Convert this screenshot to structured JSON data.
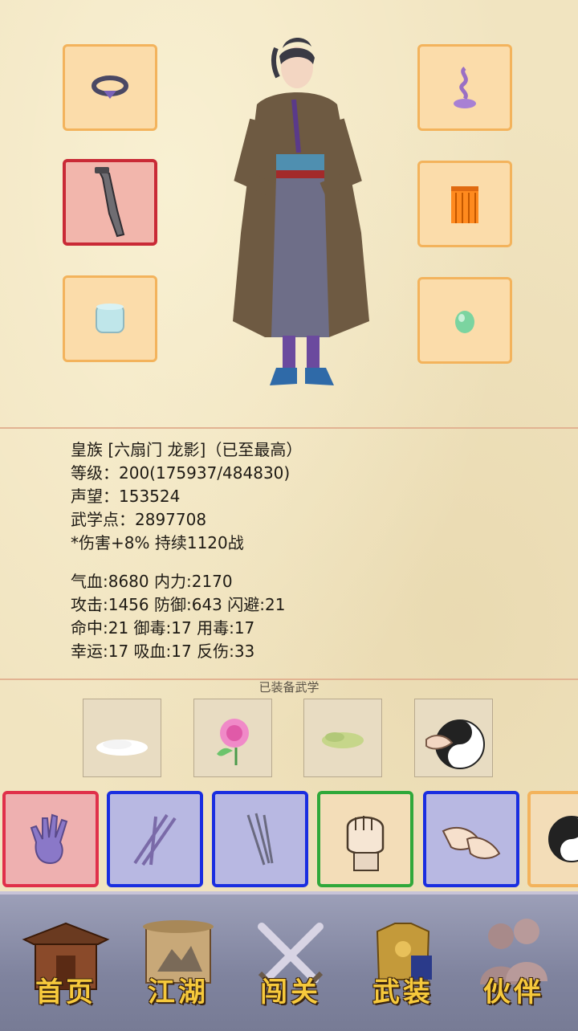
{
  "character": {
    "title_line": "皇族 [六扇门 龙影]（已至最高）",
    "level_line": "等级：200(175937/484830)",
    "reputation_line": "声望：153524",
    "martial_points_line": "武学点：2897708",
    "buff_line": "*伤害+8% 持续1120战"
  },
  "stats": {
    "row1": "气血:8680  内力:2170",
    "row2": "攻击:1456  防御:643  闪避:21",
    "row3": "命中:21  御毒:17  用毒:17",
    "row4": "幸运:17  吸血:17  反伤:33"
  },
  "equipped_section": {
    "title": "已装备武学"
  },
  "equipment_slots": [
    "ring-icon",
    "weapon-icon",
    "bracer-icon",
    "incense-icon",
    "garment-icon",
    "jade-icon"
  ],
  "skills_bar": [
    "palm-skill",
    "sword-flurry-skill",
    "blade-skill",
    "fist-skill",
    "hands-skill",
    "taiji-skill"
  ],
  "colors": {
    "accent_gold": "#f6c93c",
    "selected_red": "#c92a36",
    "slot_orange": "#f3b35c"
  },
  "nav": {
    "home": "首页",
    "jianghu": "江湖",
    "challenge": "闯关",
    "gear": "武装",
    "partner": "伙伴"
  }
}
